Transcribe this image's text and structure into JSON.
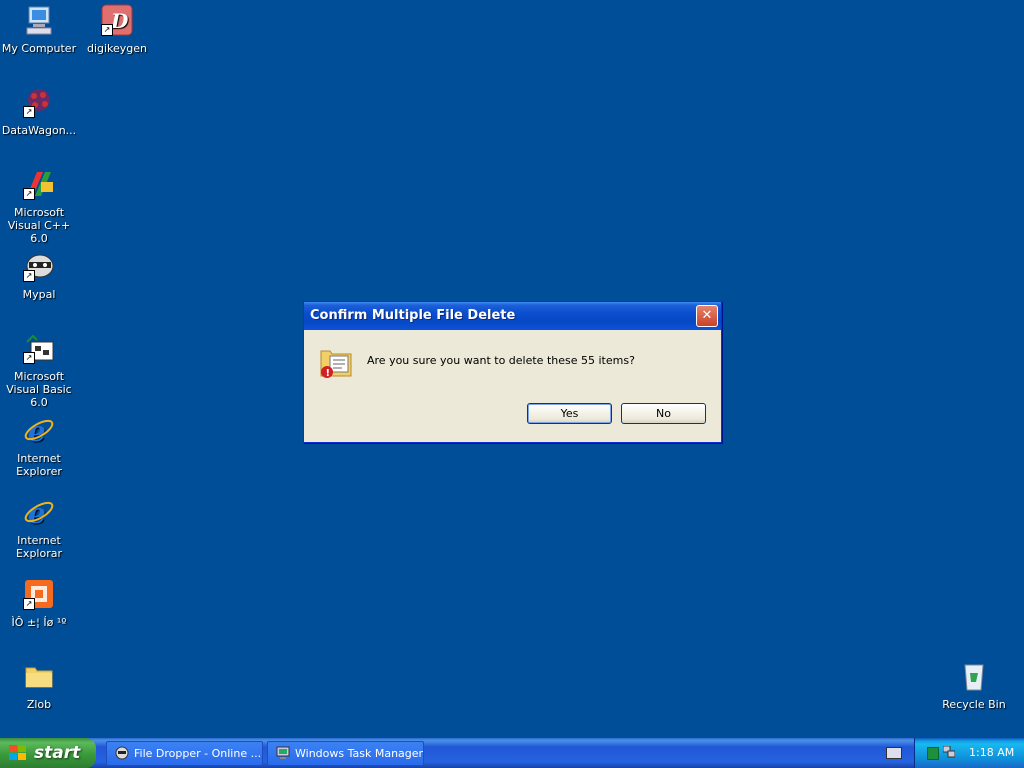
{
  "desktop": {
    "icons": [
      {
        "label": "My Computer",
        "icon": "computer-icon"
      },
      {
        "label": "digikeygen",
        "icon": "app-d-icon"
      },
      {
        "label": "DataWagon...",
        "icon": "datawagon-icon"
      },
      {
        "label": "Microsoft Visual C++ 6.0",
        "icon": "visual-cpp-icon"
      },
      {
        "label": "Mypal",
        "icon": "raccoon-icon"
      },
      {
        "label": "Microsoft Visual Basic 6.0",
        "icon": "visual-basic-icon"
      },
      {
        "label": "Internet Explorer",
        "icon": "ie-icon"
      },
      {
        "label": "Internet Explorar",
        "icon": "ie-icon"
      },
      {
        "label": "ÌÔ ±¦ Íø ¹º",
        "icon": "taobao-icon"
      },
      {
        "label": "Zlob",
        "icon": "folder-icon"
      },
      {
        "label": "Recycle Bin",
        "icon": "recycle-bin-icon"
      }
    ]
  },
  "dialog": {
    "title": "Confirm Multiple File Delete",
    "close": "✕",
    "message": "Are you sure you want to delete these 55 items?",
    "yes": "Yes",
    "no": "No"
  },
  "taskbar": {
    "start": "start",
    "tasks": [
      {
        "label": "File Dropper - Online ..."
      },
      {
        "label": "Windows Task Manager"
      }
    ],
    "clock": "1:18 AM"
  },
  "colors": {
    "desktop": "#004e98",
    "titlebar": "#0a4ecf",
    "start": "#3a9a3a"
  }
}
